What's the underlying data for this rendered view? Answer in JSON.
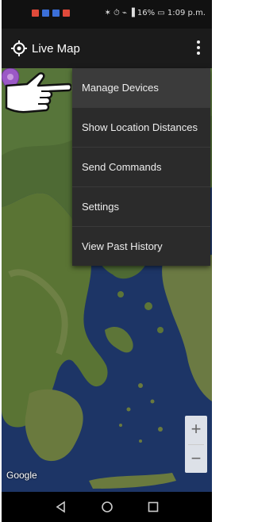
{
  "status_bar": {
    "notification_colors": [
      "#e04a3a",
      "#3b6fd8",
      "#3b6fd8",
      "#e04a3a"
    ],
    "right_text": "✶ ⏱ ⌁ ▐ 16% ▭ 1:09 p.m.",
    "icons": [
      "bluetooth-icon",
      "alarm-icon",
      "wifi-icon",
      "signal-icon",
      "battery-icon"
    ]
  },
  "app_bar": {
    "title": "Live Map",
    "logo_icon": "location-crosshair-icon",
    "overflow_icon": "more-vert-icon"
  },
  "menu": {
    "items": [
      "Manage Devices",
      "Show Location Distances",
      "Send Commands",
      "Settings",
      "View Past History"
    ]
  },
  "map": {
    "attribution": "Google",
    "zoom_in": "+",
    "zoom_out": "−",
    "marker_color": "#9b59c6"
  },
  "nav_bar": {
    "icons": [
      "back-icon",
      "home-icon",
      "recents-icon"
    ]
  },
  "colors": {
    "app_bar": "#1b1b1b",
    "menu_bg": "#2b2b2b",
    "sea": "#1a2f5a",
    "land": "#4e6a34"
  }
}
